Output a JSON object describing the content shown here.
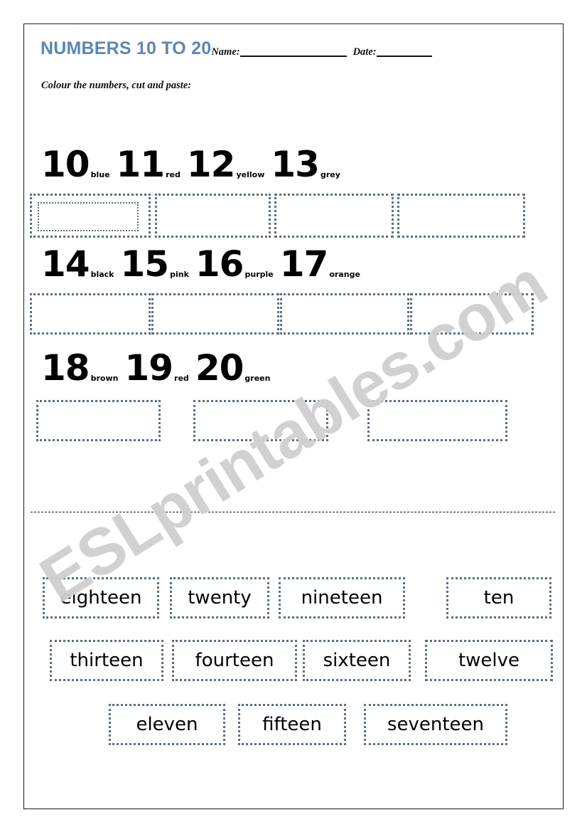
{
  "page": {
    "watermark": "ESLprintables.com",
    "border_color": "#1a1a1a",
    "background": "#ffffff"
  },
  "header": {
    "title": "NUMBERS 10 TO 20",
    "title_color": "#5b87b5",
    "name_label": "Name:",
    "date_label": "Date:",
    "instruction": "Colour the numbers, cut and paste:"
  },
  "number_rows": [
    {
      "items": [
        {
          "number": "10",
          "colour": "blue"
        },
        {
          "number": "11",
          "colour": "red"
        },
        {
          "number": "12",
          "colour": "yellow"
        },
        {
          "number": "13",
          "colour": "grey"
        }
      ]
    },
    {
      "items": [
        {
          "number": "14",
          "colour": "black"
        },
        {
          "number": "15",
          "colour": "pink"
        },
        {
          "number": "16",
          "colour": "purple"
        },
        {
          "number": "17",
          "colour": "orange"
        }
      ]
    },
    {
      "items": [
        {
          "number": "18",
          "colour": "brown"
        },
        {
          "number": "19",
          "colour": "red"
        },
        {
          "number": "20",
          "colour": "green"
        }
      ]
    }
  ],
  "paste_box_rows": [
    {
      "count": 4
    },
    {
      "count": 4
    },
    {
      "count": 3
    }
  ],
  "word_cards": [
    {
      "label": "eighteen"
    },
    {
      "label": "twenty"
    },
    {
      "label": "nineteen"
    },
    {
      "label": "ten"
    },
    {
      "label": "thirteen"
    },
    {
      "label": "fourteen"
    },
    {
      "label": "sixteen"
    },
    {
      "label": "twelve"
    },
    {
      "label": "eleven"
    },
    {
      "label": "fifteen"
    },
    {
      "label": "seventeen"
    }
  ],
  "style": {
    "dotted_border_color": "#5a6e80",
    "separator_color": "#111111"
  }
}
